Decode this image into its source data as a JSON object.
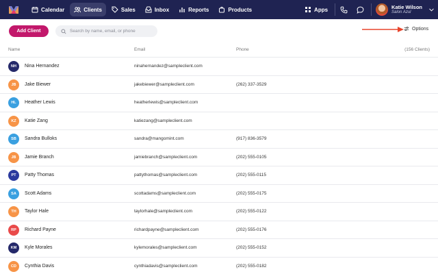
{
  "nav": {
    "items": [
      {
        "label": "Calendar",
        "icon": "calendar-icon",
        "active": false
      },
      {
        "label": "Clients",
        "icon": "users-icon",
        "active": true
      },
      {
        "label": "Sales",
        "icon": "tag-icon",
        "active": false
      },
      {
        "label": "Inbox",
        "icon": "inbox-icon",
        "active": false
      },
      {
        "label": "Reports",
        "icon": "chart-icon",
        "active": false
      },
      {
        "label": "Products",
        "icon": "bag-icon",
        "active": false
      }
    ],
    "apps_label": "Apps",
    "user": {
      "name": "Katie Wilson",
      "salon": "Salon Azul"
    }
  },
  "toolbar": {
    "add_label": "Add Client",
    "search_placeholder": "Search by name, email, or phone",
    "options_label": "Options"
  },
  "table": {
    "headers": {
      "name": "Name",
      "email": "Email",
      "phone": "Phone",
      "count": "(156 Clients)"
    },
    "rows": [
      {
        "initials": "NH",
        "color": "#25296a",
        "name": "Nina Hernandez",
        "email": "ninahernandez@sampleclient.com",
        "phone": ""
      },
      {
        "initials": "JB",
        "color": "#f79447",
        "name": "Jake Biewer",
        "email": "jakebiewer@sampleclient.com",
        "phone": "(262) 337-3529"
      },
      {
        "initials": "HL",
        "color": "#3aa0e0",
        "name": "Heather Lewis",
        "email": "heatherlewis@sampleclient.com",
        "phone": ""
      },
      {
        "initials": "KZ",
        "color": "#f79447",
        "name": "Katie Zang",
        "email": "katiezang@sampleclient.com",
        "phone": ""
      },
      {
        "initials": "SB",
        "color": "#3aa0e0",
        "name": "Sandra Bulloks",
        "email": "sandra@mangomint.com",
        "phone": "(917) 836-3579"
      },
      {
        "initials": "JB",
        "color": "#f79447",
        "name": "Jamie Branch",
        "email": "jamiebranch@sampleclient.com",
        "phone": "(202) 555-0105"
      },
      {
        "initials": "PT",
        "color": "#2b3a9e",
        "name": "Patty Thomas",
        "email": "pattythomas@sampleclient.com",
        "phone": "(202) 555-0115"
      },
      {
        "initials": "SA",
        "color": "#3aa0e0",
        "name": "Scott Adams",
        "email": "scottadams@sampleclient.com",
        "phone": "(202) 555-0175"
      },
      {
        "initials": "TH",
        "color": "#f79447",
        "name": "Taylor Hale",
        "email": "taylorhale@sampleclient.com",
        "phone": "(202) 555-0122"
      },
      {
        "initials": "RP",
        "color": "#e94a4a",
        "name": "Richard Payne",
        "email": "richardpayne@sampleclient.com",
        "phone": "(202) 555-0176"
      },
      {
        "initials": "KM",
        "color": "#25296a",
        "name": "Kyle Morales",
        "email": "kylemorales@sampleclient.com",
        "phone": "(202) 555-0152"
      },
      {
        "initials": "CD",
        "color": "#f79447",
        "name": "Cynthia Davis",
        "email": "cynthiadavis@sampleclient.com",
        "phone": "(202) 555-0182"
      }
    ]
  },
  "colors": {
    "nav_bg": "#1f2352",
    "accent": "#c2186b",
    "annotation_arrow": "#e8452c"
  }
}
